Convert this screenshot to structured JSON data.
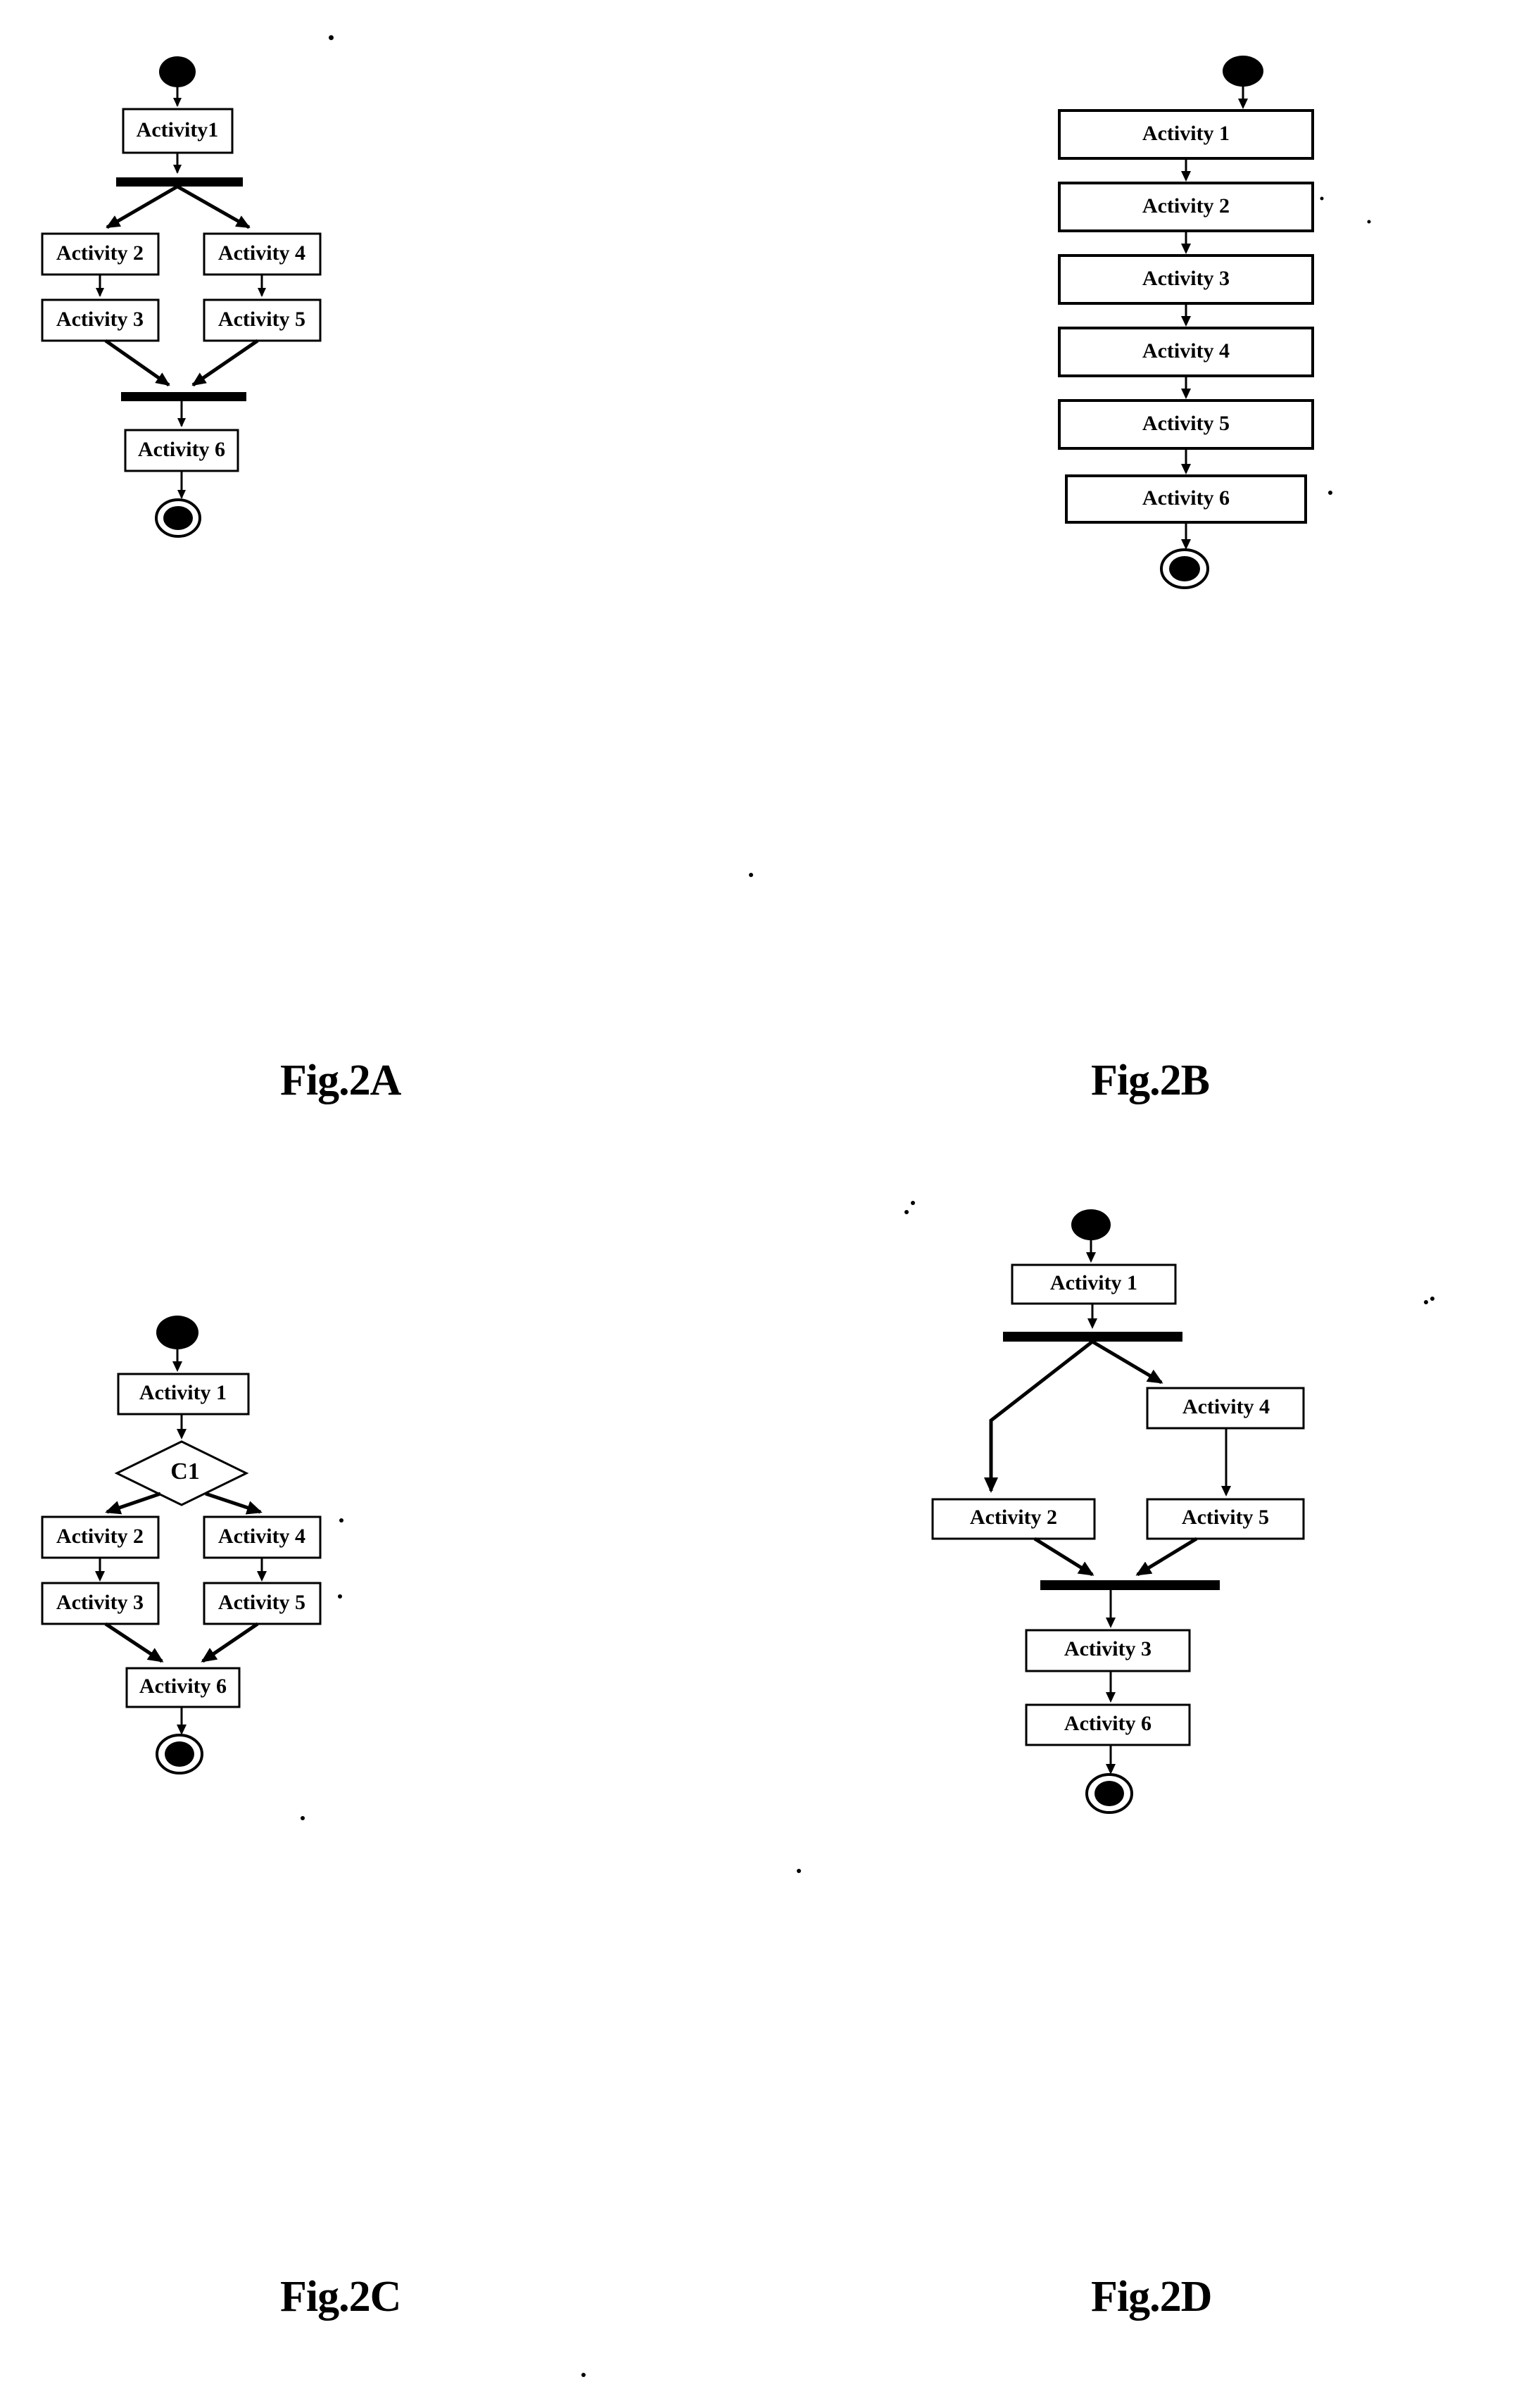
{
  "document": {
    "kind": "patent-drawing-sheet",
    "diagram_type": "uml-activity-diagram"
  },
  "figures": [
    {
      "id": "fig-2a",
      "caption": "Fig.2A",
      "nodes": {
        "start": "start-node",
        "end": "end-node",
        "activity1": "Activity1",
        "activity2": "Activity 2",
        "activity3": "Activity 3",
        "activity4": "Activity 4",
        "activity5": "Activity 5",
        "activity6": "Activity 6",
        "fork": "fork-bar",
        "join": "join-bar"
      },
      "flow": [
        "start -> Activity1",
        "Activity1 -> fork",
        "fork -> Activity 2",
        "fork -> Activity 4",
        "Activity 2 -> Activity 3",
        "Activity 4 -> Activity 5",
        "Activity 3 -> join",
        "Activity 5 -> join",
        "join -> Activity 6",
        "Activity 6 -> end"
      ]
    },
    {
      "id": "fig-2b",
      "caption": "Fig.2B",
      "nodes": {
        "start": "start-node",
        "end": "end-node",
        "activity1": "Activity 1",
        "activity2": "Activity 2",
        "activity3": "Activity 3",
        "activity4": "Activity 4",
        "activity5": "Activity 5",
        "activity6": "Activity 6"
      },
      "flow": [
        "start -> Activity 1",
        "Activity 1 -> Activity 2",
        "Activity 2 -> Activity 3",
        "Activity 3 -> Activity 4",
        "Activity 4 -> Activity 5",
        "Activity 5 -> Activity 6",
        "Activity 6 -> end"
      ]
    },
    {
      "id": "fig-2c",
      "caption": "Fig.2C",
      "nodes": {
        "start": "start-node",
        "end": "end-node",
        "activity1": "Activity 1",
        "condition": "C1",
        "activity2": "Activity 2",
        "activity3": "Activity 3",
        "activity4": "Activity 4",
        "activity5": "Activity 5",
        "activity6": "Activity 6"
      },
      "flow": [
        "start -> Activity 1",
        "Activity 1 -> C1",
        "C1 -> Activity 2",
        "C1 -> Activity 4",
        "Activity 2 -> Activity 3",
        "Activity 4 -> Activity 5",
        "Activity 3 -> Activity 6",
        "Activity 5 -> Activity 6",
        "Activity 6 -> end"
      ]
    },
    {
      "id": "fig-2d",
      "caption": "Fig.2D",
      "nodes": {
        "start": "start-node",
        "end": "end-node",
        "activity1": "Activity 1",
        "activity2": "Activity 2",
        "activity3": "Activity 3",
        "activity4": "Activity 4",
        "activity5": "Activity 5",
        "activity6": "Activity 6",
        "fork": "fork-bar",
        "join": "join-bar"
      },
      "flow": [
        "start -> Activity 1",
        "Activity 1 -> fork",
        "fork -> Activity 2",
        "fork -> Activity 4",
        "Activity 4 -> Activity 5",
        "Activity 2 -> join",
        "Activity 5 -> join",
        "join -> Activity 3",
        "Activity 3 -> Activity 6",
        "Activity 6 -> end"
      ]
    }
  ],
  "style": {
    "ink": "#000000",
    "paper": "#ffffff"
  }
}
